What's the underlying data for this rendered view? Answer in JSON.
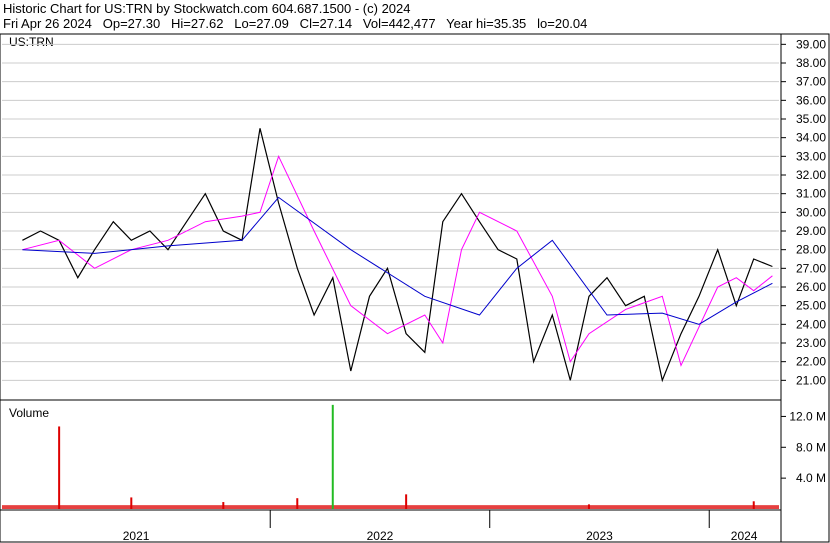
{
  "header": {
    "line1": "Historic Chart for US:TRN by Stockwatch.com 604.687.1500 - (c) 2024",
    "line2": "Fri Apr 26 2024   Op=27.30   Hi=27.62   Lo=27.09   Cl=27.14   Vol=442,477   Year hi=35.35   lo=20.04"
  },
  "colors": {
    "price": "#000000",
    "ma_short": "#ff00ff",
    "ma_long": "#0000cc",
    "vol_up": "#22bb22",
    "vol_down": "#dd0000",
    "grid": "#cccccc"
  },
  "chart_data": [
    {
      "type": "line",
      "panel": "price",
      "symbol_label": "US:TRN",
      "y_ticks": [
        "39.00",
        "38.00",
        "37.00",
        "36.00",
        "35.00",
        "34.00",
        "33.00",
        "32.00",
        "31.00",
        "30.00",
        "29.00",
        "28.00",
        "27.00",
        "26.00",
        "25.00",
        "24.00",
        "23.00",
        "22.00",
        "21.00"
      ],
      "ylim": [
        20,
        39.5
      ],
      "x_labels": [
        "2021",
        "2022",
        "2023",
        "2024"
      ],
      "series": [
        {
          "x": [
            "2020-11",
            "2020-12",
            "2021-01",
            "2021-02",
            "2021-03",
            "2021-04",
            "2021-05",
            "2021-06",
            "2021-07",
            "2021-08",
            "2021-09",
            "2021-10",
            "2021-11",
            "2021-12",
            "2022-01",
            "2022-02",
            "2022-03",
            "2022-04",
            "2022-05",
            "2022-06",
            "2022-07",
            "2022-08",
            "2022-09",
            "2022-10",
            "2022-11",
            "2022-12",
            "2023-01",
            "2023-02",
            "2023-03",
            "2023-04",
            "2023-05",
            "2023-06",
            "2023-07",
            "2023-08",
            "2023-09",
            "2023-10",
            "2023-11",
            "2023-12",
            "2024-01",
            "2024-02",
            "2024-03",
            "2024-04"
          ],
          "values": [
            28.5,
            29.0,
            28.5,
            26.5,
            28.0,
            29.5,
            28.5,
            29.0,
            28.0,
            29.5,
            31.0,
            29.0,
            28.5,
            34.5,
            30.5,
            27.0,
            24.5,
            26.5,
            21.5,
            25.5,
            27.0,
            23.5,
            22.5,
            29.5,
            31.0,
            29.5,
            28.0,
            27.5,
            22.0,
            24.5,
            21.0,
            25.5,
            26.5,
            25.0,
            25.5,
            21.0,
            23.5,
            25.5,
            28.0,
            25.0,
            27.5,
            27.1
          ]
        },
        {
          "name": "",
          "x": [
            "2020-11",
            "2021-01",
            "2021-03",
            "2021-05",
            "2021-07",
            "2021-09",
            "2021-11",
            "2021-12",
            "2022-01",
            "2022-03",
            "2022-05",
            "2022-07",
            "2022-09",
            "2022-10",
            "2022-11",
            "2022-12",
            "2023-02",
            "2023-04",
            "2023-05",
            "2023-06",
            "2023-08",
            "2023-10",
            "2023-11",
            "2024-01",
            "2024-02",
            "2024-03",
            "2024-04"
          ],
          "values": [
            28.0,
            28.5,
            27.0,
            28.0,
            28.5,
            29.5,
            29.8,
            30.0,
            33.0,
            29.0,
            25.0,
            23.5,
            24.5,
            23.0,
            28.0,
            30.0,
            29.0,
            25.5,
            22.0,
            23.5,
            24.8,
            25.5,
            21.8,
            26.0,
            26.5,
            25.8,
            26.6
          ]
        },
        {
          "name": "",
          "x": [
            "2020-11",
            "2021-03",
            "2021-07",
            "2021-11",
            "2022-01",
            "2022-05",
            "2022-09",
            "2022-12",
            "2023-02",
            "2023-04",
            "2023-07",
            "2023-10",
            "2023-12",
            "2024-02",
            "2024-04"
          ],
          "values": [
            28.0,
            27.8,
            28.2,
            28.5,
            30.8,
            28.0,
            25.5,
            24.5,
            27.0,
            28.5,
            24.5,
            24.6,
            24.0,
            25.2,
            26.2
          ]
        }
      ]
    },
    {
      "type": "bar",
      "panel": "volume",
      "title": "Volume",
      "y_ticks": [
        "12.0 M",
        "8.0 M",
        "4.0 M"
      ],
      "ylim": [
        0,
        14
      ],
      "spikes": [
        {
          "x": "2021-01",
          "value": 10.7
        },
        {
          "x": "2021-05",
          "value": 1.5
        },
        {
          "x": "2021-10",
          "value": 0.9
        },
        {
          "x": "2022-02",
          "value": 1.4
        },
        {
          "x": "2022-04",
          "value": 13.5
        },
        {
          "x": "2022-08",
          "value": 1.9
        },
        {
          "x": "2023-06",
          "value": 0.6
        },
        {
          "x": "2024-03",
          "value": 1.0
        }
      ],
      "baseline_value": 0.5
    }
  ]
}
